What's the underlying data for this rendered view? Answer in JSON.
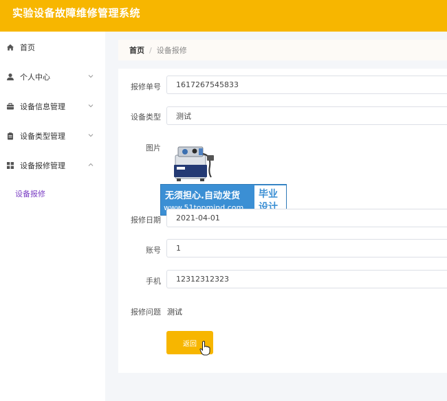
{
  "app": {
    "title": "实验设备故障维修管理系统"
  },
  "sidebar": {
    "items": [
      {
        "label": "首页",
        "icon": "home-icon"
      },
      {
        "label": "个人中心",
        "icon": "user-icon"
      },
      {
        "label": "设备信息管理",
        "icon": "briefcase-icon"
      },
      {
        "label": "设备类型管理",
        "icon": "clipboard-icon"
      },
      {
        "label": "设备报修管理",
        "icon": "grid-icon"
      }
    ],
    "sub_item": "设备报修"
  },
  "breadcrumb": {
    "home": "首页",
    "separator": "/",
    "current": "设备报修"
  },
  "form": {
    "order_no": {
      "label": "报修单号",
      "value": "1617267545833"
    },
    "device_type": {
      "label": "设备类型",
      "value": "测试"
    },
    "image": {
      "label": "图片"
    },
    "repair_date": {
      "label": "报修日期",
      "value": "2021-04-01"
    },
    "account": {
      "label": "账号",
      "value": "1"
    },
    "phone": {
      "label": "手机",
      "value": "12312312323"
    },
    "issue": {
      "label": "报修问题",
      "value": "测试"
    },
    "back_button": "返回"
  },
  "watermark": {
    "line1": "无须担心.自动发货",
    "line2": "www.51topmind.com",
    "right_line1": "毕业",
    "right_line2": "设计"
  },
  "colors": {
    "accent": "#f7b600",
    "submenu_active": "#7b3fc4",
    "watermark": "#3b8fd4"
  }
}
